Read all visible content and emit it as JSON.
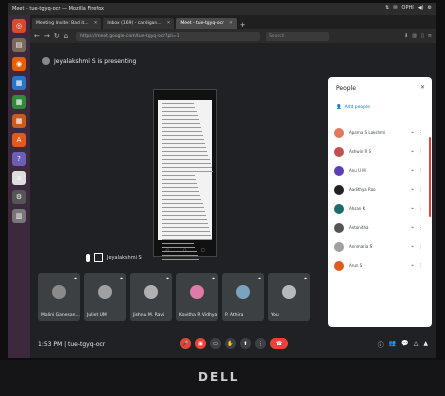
{
  "window_title": "Meet - tue-tgyq-ocr — Mozilla Firefox",
  "tray": [
    "⇅",
    "✉",
    "OPHI",
    "◀)",
    "⚙"
  ],
  "launcher": [
    {
      "icon": "ubuntu-icon",
      "glyph": "◎",
      "color": "#d64b2b"
    },
    {
      "icon": "files-icon",
      "glyph": "▤",
      "color": "#7a6a5a"
    },
    {
      "icon": "firefox-icon",
      "glyph": "◉",
      "color": "#e66000"
    },
    {
      "icon": "writer-icon",
      "glyph": "▦",
      "color": "#2a76c6"
    },
    {
      "icon": "calc-icon",
      "glyph": "▦",
      "color": "#2f8a3a"
    },
    {
      "icon": "impress-icon",
      "glyph": "▦",
      "color": "#c95b1e"
    },
    {
      "icon": "software-icon",
      "glyph": "A",
      "color": "#e05a1c"
    },
    {
      "icon": "help-icon",
      "glyph": "?",
      "color": "#6b5fb5"
    },
    {
      "icon": "amazon-icon",
      "glyph": "a",
      "color": "#ddd"
    },
    {
      "icon": "settings-icon",
      "glyph": "⚙",
      "color": "#555"
    },
    {
      "icon": "trash-icon",
      "glyph": "▥",
      "color": "#777"
    }
  ],
  "tabs": [
    {
      "label": "Meeting Invite: Bad it..."
    },
    {
      "label": "Inbox (169) - cardigan..."
    },
    {
      "label": "Meet - tue-tgyq-ocr",
      "active": true
    }
  ],
  "url": "https://meet.google.com/tue-tgyq-ocr?pli=1",
  "search_placeholder": "Search",
  "presenting": "Jeyalakshmi S is presenting",
  "mini_name": "Jeyalakshmi S",
  "tiles": [
    {
      "name": "Malini Ganesan...",
      "avatar_color": "#8a8a8a"
    },
    {
      "name": "Juliet UM",
      "avatar_color": "#a0a0a0"
    },
    {
      "name": "Jishnu M. Ravi",
      "avatar_color": "#b0b0b0"
    },
    {
      "name": "Kavitha R Vidhya",
      "avatar_color": "#e07aa8"
    },
    {
      "name": "P. Athira",
      "avatar_color": "#7aa3c0"
    },
    {
      "name": "You",
      "avatar_color": "#b8b8b8"
    }
  ],
  "clock": "1:53 PM  |  tue-tgyq-ocr",
  "controls": [
    {
      "icon": "mic-off-icon",
      "glyph": "🎤",
      "color": "#ea4335"
    },
    {
      "icon": "camera-off-icon",
      "glyph": "▣",
      "color": "#ea4335"
    },
    {
      "icon": "captions-icon",
      "glyph": "▭",
      "color": "#3c4043"
    },
    {
      "icon": "raise-hand-icon",
      "glyph": "✋",
      "color": "#3c4043"
    },
    {
      "icon": "present-icon",
      "glyph": "⬆",
      "color": "#3c4043"
    },
    {
      "icon": "more-options-icon",
      "glyph": "⋮",
      "color": "#3c4043"
    }
  ],
  "leave_glyph": "☎",
  "right_controls": [
    "ⓘ",
    "👥",
    "💬",
    "△",
    "▲"
  ],
  "people": {
    "title": "People",
    "add_label": "Add people",
    "list": [
      {
        "name": "Aparna S Lakshmi",
        "color": "#e07a5f"
      },
      {
        "name": "Ashwin R S",
        "color": "#c05050"
      },
      {
        "name": "Anu U M",
        "color": "#5a3fb5"
      },
      {
        "name": "Aadithya Rao",
        "color": "#222"
      },
      {
        "name": "Ahsan K",
        "color": "#1f6b6b"
      },
      {
        "name": "Antonitha",
        "color": "#555"
      },
      {
        "name": "Annmaria S",
        "color": "#a0a0a0"
      },
      {
        "name": "Arun S",
        "color": "#e05a1c"
      }
    ]
  }
}
